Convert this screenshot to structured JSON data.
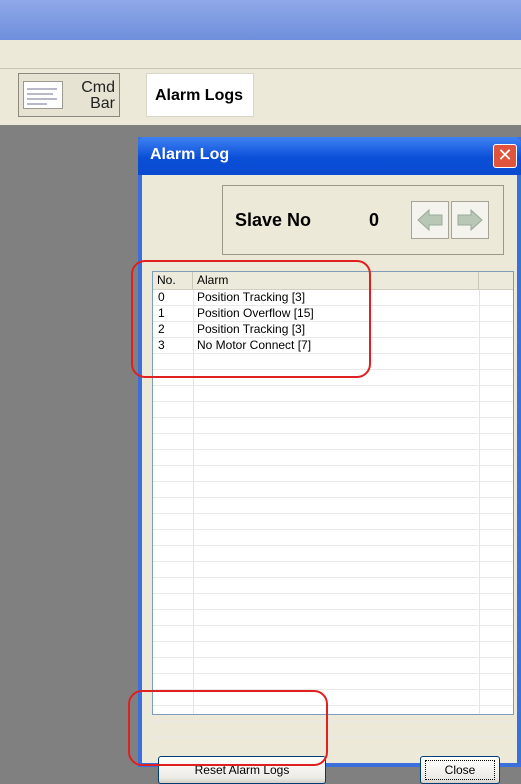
{
  "toolbar": {
    "cmd_bar_label": "Cmd\nBar",
    "alarm_logs_tab": "Alarm Logs"
  },
  "dialog": {
    "title": "Alarm Log",
    "close_glyph": "✕",
    "slave": {
      "label": "Slave No",
      "value": "0"
    },
    "list": {
      "columns": [
        "No.",
        "Alarm",
        ""
      ],
      "rows": [
        {
          "no": "0",
          "alarm": "Position Tracking [3]"
        },
        {
          "no": "1",
          "alarm": "Position Overflow [15]"
        },
        {
          "no": "2",
          "alarm": "Position Tracking [3]"
        },
        {
          "no": "3",
          "alarm": "No Motor Connect [7]"
        }
      ]
    },
    "reset_button": "Reset Alarm Logs",
    "close_button": "Close"
  },
  "icons": {
    "prev": "arrow-left-icon",
    "next": "arrow-right-icon",
    "cmd_bar": "toolbar-thumbnail-icon"
  },
  "colors": {
    "title_bar": "#0a4fd8",
    "close_button": "#e0543b",
    "annotation": "#e02020",
    "dialog_body": "#ece9d8"
  }
}
